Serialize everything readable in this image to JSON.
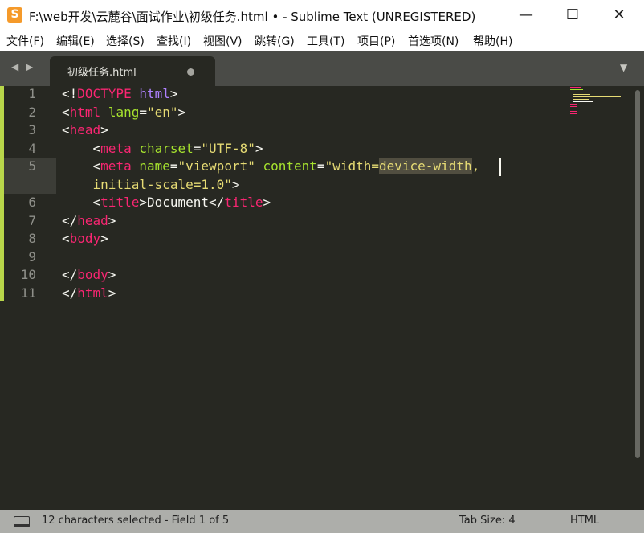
{
  "window": {
    "icon_letter": "S",
    "title": "F:\\web开发\\云麓谷\\面试作业\\初级任务.html • - Sublime Text (UNREGISTERED)",
    "controls": {
      "minimize": "—",
      "maximize": "☐",
      "close": "✕"
    }
  },
  "menu": [
    "文件(F)",
    "编辑(E)",
    "选择(S)",
    "查找(I)",
    "视图(V)",
    "跳转(G)",
    "工具(T)",
    "项目(P)",
    "首选项(N)",
    "帮助(H)"
  ],
  "tabs": {
    "nav_back": "◀",
    "nav_forward": "▶",
    "active_tab": "初级任务.html",
    "dropdown": "▼"
  },
  "editor": {
    "line_numbers": [
      "1",
      "2",
      "3",
      "4",
      "5",
      "",
      "6",
      "7",
      "8",
      "9",
      "10",
      "11"
    ],
    "code": [
      [
        {
          "c": "w",
          "t": "<!"
        },
        {
          "c": "t",
          "t": "DOCTYPE"
        },
        {
          "c": "w",
          "t": " "
        },
        {
          "c": "d",
          "t": "html"
        },
        {
          "c": "w",
          "t": ">"
        }
      ],
      [
        {
          "c": "w",
          "t": "<"
        },
        {
          "c": "t",
          "t": "html"
        },
        {
          "c": "w",
          "t": " "
        },
        {
          "c": "a",
          "t": "lang"
        },
        {
          "c": "w",
          "t": "="
        },
        {
          "c": "s",
          "t": "\"en\""
        },
        {
          "c": "w",
          "t": ">"
        }
      ],
      [
        {
          "c": "w",
          "t": "<"
        },
        {
          "c": "t",
          "t": "head"
        },
        {
          "c": "w",
          "t": ">"
        }
      ],
      [
        {
          "c": "w",
          "t": "    <"
        },
        {
          "c": "t",
          "t": "meta"
        },
        {
          "c": "w",
          "t": " "
        },
        {
          "c": "a",
          "t": "charset"
        },
        {
          "c": "w",
          "t": "="
        },
        {
          "c": "s",
          "t": "\"UTF-8\""
        },
        {
          "c": "w",
          "t": ">"
        }
      ],
      [
        {
          "c": "w",
          "t": "    <"
        },
        {
          "c": "t",
          "t": "meta"
        },
        {
          "c": "w",
          "t": " "
        },
        {
          "c": "a",
          "t": "name"
        },
        {
          "c": "w",
          "t": "="
        },
        {
          "c": "s",
          "t": "\"viewport\""
        },
        {
          "c": "w",
          "t": " "
        },
        {
          "c": "a",
          "t": "content"
        },
        {
          "c": "w",
          "t": "="
        },
        {
          "c": "s",
          "t": "\"width="
        },
        {
          "c": "s hl",
          "t": "device-width"
        },
        {
          "c": "s",
          "t": ","
        }
      ],
      [
        {
          "c": "s",
          "t": "    initial-scale=1.0\""
        },
        {
          "c": "w",
          "t": ">"
        }
      ],
      [
        {
          "c": "w",
          "t": "    <"
        },
        {
          "c": "t",
          "t": "title"
        },
        {
          "c": "w",
          "t": ">Document</"
        },
        {
          "c": "t",
          "t": "title"
        },
        {
          "c": "w",
          "t": ">"
        }
      ],
      [
        {
          "c": "w",
          "t": "</"
        },
        {
          "c": "t",
          "t": "head"
        },
        {
          "c": "w",
          "t": ">"
        }
      ],
      [
        {
          "c": "w",
          "t": "<"
        },
        {
          "c": "t",
          "t": "body"
        },
        {
          "c": "w",
          "t": ">"
        }
      ],
      [],
      [
        {
          "c": "w",
          "t": "</"
        },
        {
          "c": "t",
          "t": "body"
        },
        {
          "c": "w",
          "t": ">"
        }
      ],
      [
        {
          "c": "w",
          "t": "</"
        },
        {
          "c": "t",
          "t": "html"
        },
        {
          "c": "w",
          "t": ">"
        }
      ]
    ]
  },
  "status": {
    "selection": "12 characters selected - Field 1 of 5",
    "tab_size": "Tab Size: 4",
    "syntax": "HTML"
  },
  "colors": {
    "editor_bg": "#272822",
    "tag": "#f92672",
    "attribute": "#a6e22e",
    "string": "#e6db74",
    "keyword": "#ae81ff",
    "modified_gutter": "#b8d64a"
  }
}
